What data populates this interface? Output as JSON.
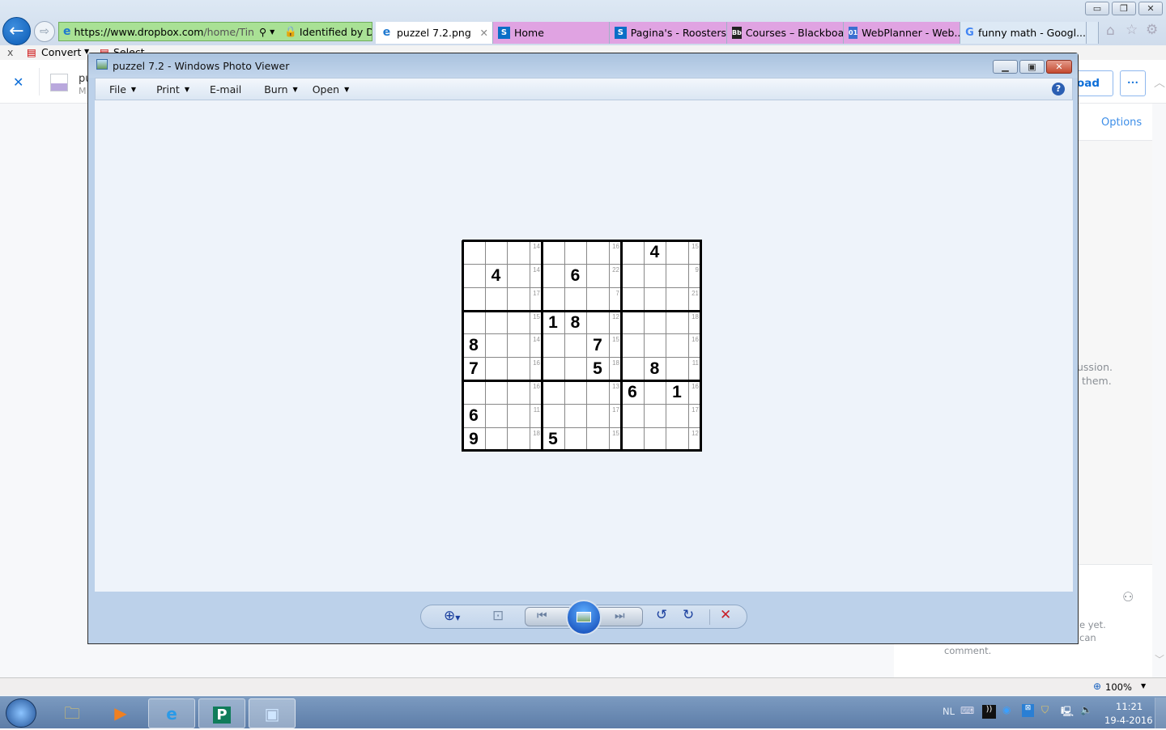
{
  "browser": {
    "window_controls": {
      "minimize": "▭",
      "restore": "❐",
      "close": "✕"
    },
    "address": {
      "url_host": "https://www.dropbox.com",
      "url_path": "/home/Tin",
      "identity": "Identified by D...",
      "search_icon": "search-icon",
      "refresh_icon": "refresh-icon"
    },
    "tabs": [
      {
        "label": "puzzel 7.2.png",
        "icon": "ie-icon",
        "active": true,
        "color": "#ffffff",
        "close": "✕"
      },
      {
        "label": "Home",
        "icon": "sharepoint-icon",
        "color": "#e0a3e2"
      },
      {
        "label": "Pagina's - Roosters",
        "icon": "sharepoint-icon",
        "color": "#e0a3e2"
      },
      {
        "label": "Courses – Blackboa...",
        "icon": "blackboard-icon",
        "color": "#e0a3e2"
      },
      {
        "label": "WebPlanner - Web...",
        "icon": "webplanner-icon",
        "color": "#e0a3e2"
      },
      {
        "label": "funny math - Googl...",
        "icon": "google-icon",
        "color": "#dde9f5"
      }
    ],
    "commandbar": {
      "close": "x",
      "convert": "Convert",
      "select": "Select"
    },
    "zoom": "100%"
  },
  "dropbox": {
    "close": "✕",
    "file_name_partial": "pu",
    "file_meta_partial": "M",
    "download_partial": "load",
    "more": "•••",
    "options": "Options",
    "discussion_line1": "ussion.",
    "discussion_line2": "them.",
    "comment_line1": "e yet.",
    "comment_line2": "can",
    "comment_line3": "comment."
  },
  "photo_viewer": {
    "title": "puzzel 7.2 - Windows Photo Viewer",
    "menu": [
      {
        "label": "File",
        "dropdown": true
      },
      {
        "label": "Print",
        "dropdown": true
      },
      {
        "label": "E-mail",
        "dropdown": false
      },
      {
        "label": "Burn",
        "dropdown": true
      },
      {
        "label": "Open",
        "dropdown": true
      }
    ],
    "help": "?"
  },
  "sudoku": {
    "rows": [
      {
        "digits": [
          "",
          "",
          "",
          "",
          "",
          "",
          "",
          "4",
          ""
        ],
        "clues": [
          "14",
          "16",
          "15"
        ]
      },
      {
        "digits": [
          "",
          "4",
          "",
          "",
          "6",
          "",
          "",
          "",
          ""
        ],
        "clues": [
          "14",
          "22",
          "9"
        ]
      },
      {
        "digits": [
          "",
          "",
          "",
          "",
          "",
          "",
          "",
          "",
          ""
        ],
        "clues": [
          "17",
          "7",
          "21"
        ]
      },
      {
        "digits": [
          "",
          "",
          "",
          "1",
          "8",
          "",
          "",
          "",
          ""
        ],
        "clues": [
          "15",
          "12",
          "18"
        ]
      },
      {
        "digits": [
          "8",
          "",
          "",
          "",
          "",
          "7",
          "",
          "",
          ""
        ],
        "clues": [
          "14",
          "15",
          "16"
        ]
      },
      {
        "digits": [
          "7",
          "",
          "",
          "",
          "",
          "5",
          "",
          "8",
          ""
        ],
        "clues": [
          "16",
          "18",
          "11"
        ]
      },
      {
        "digits": [
          "",
          "",
          "",
          "",
          "",
          "",
          "6",
          "",
          "1"
        ],
        "clues": [
          "16",
          "13",
          "16"
        ]
      },
      {
        "digits": [
          "6",
          "",
          "",
          "",
          "",
          "",
          "",
          "",
          ""
        ],
        "clues": [
          "11",
          "17",
          "17"
        ]
      },
      {
        "digits": [
          "9",
          "",
          "",
          "5",
          "",
          "",
          "",
          "",
          ""
        ],
        "clues": [
          "18",
          "15",
          "12"
        ]
      }
    ]
  },
  "taskbar": {
    "language": "NL",
    "time": "11:21",
    "date": "19-4-2016"
  }
}
